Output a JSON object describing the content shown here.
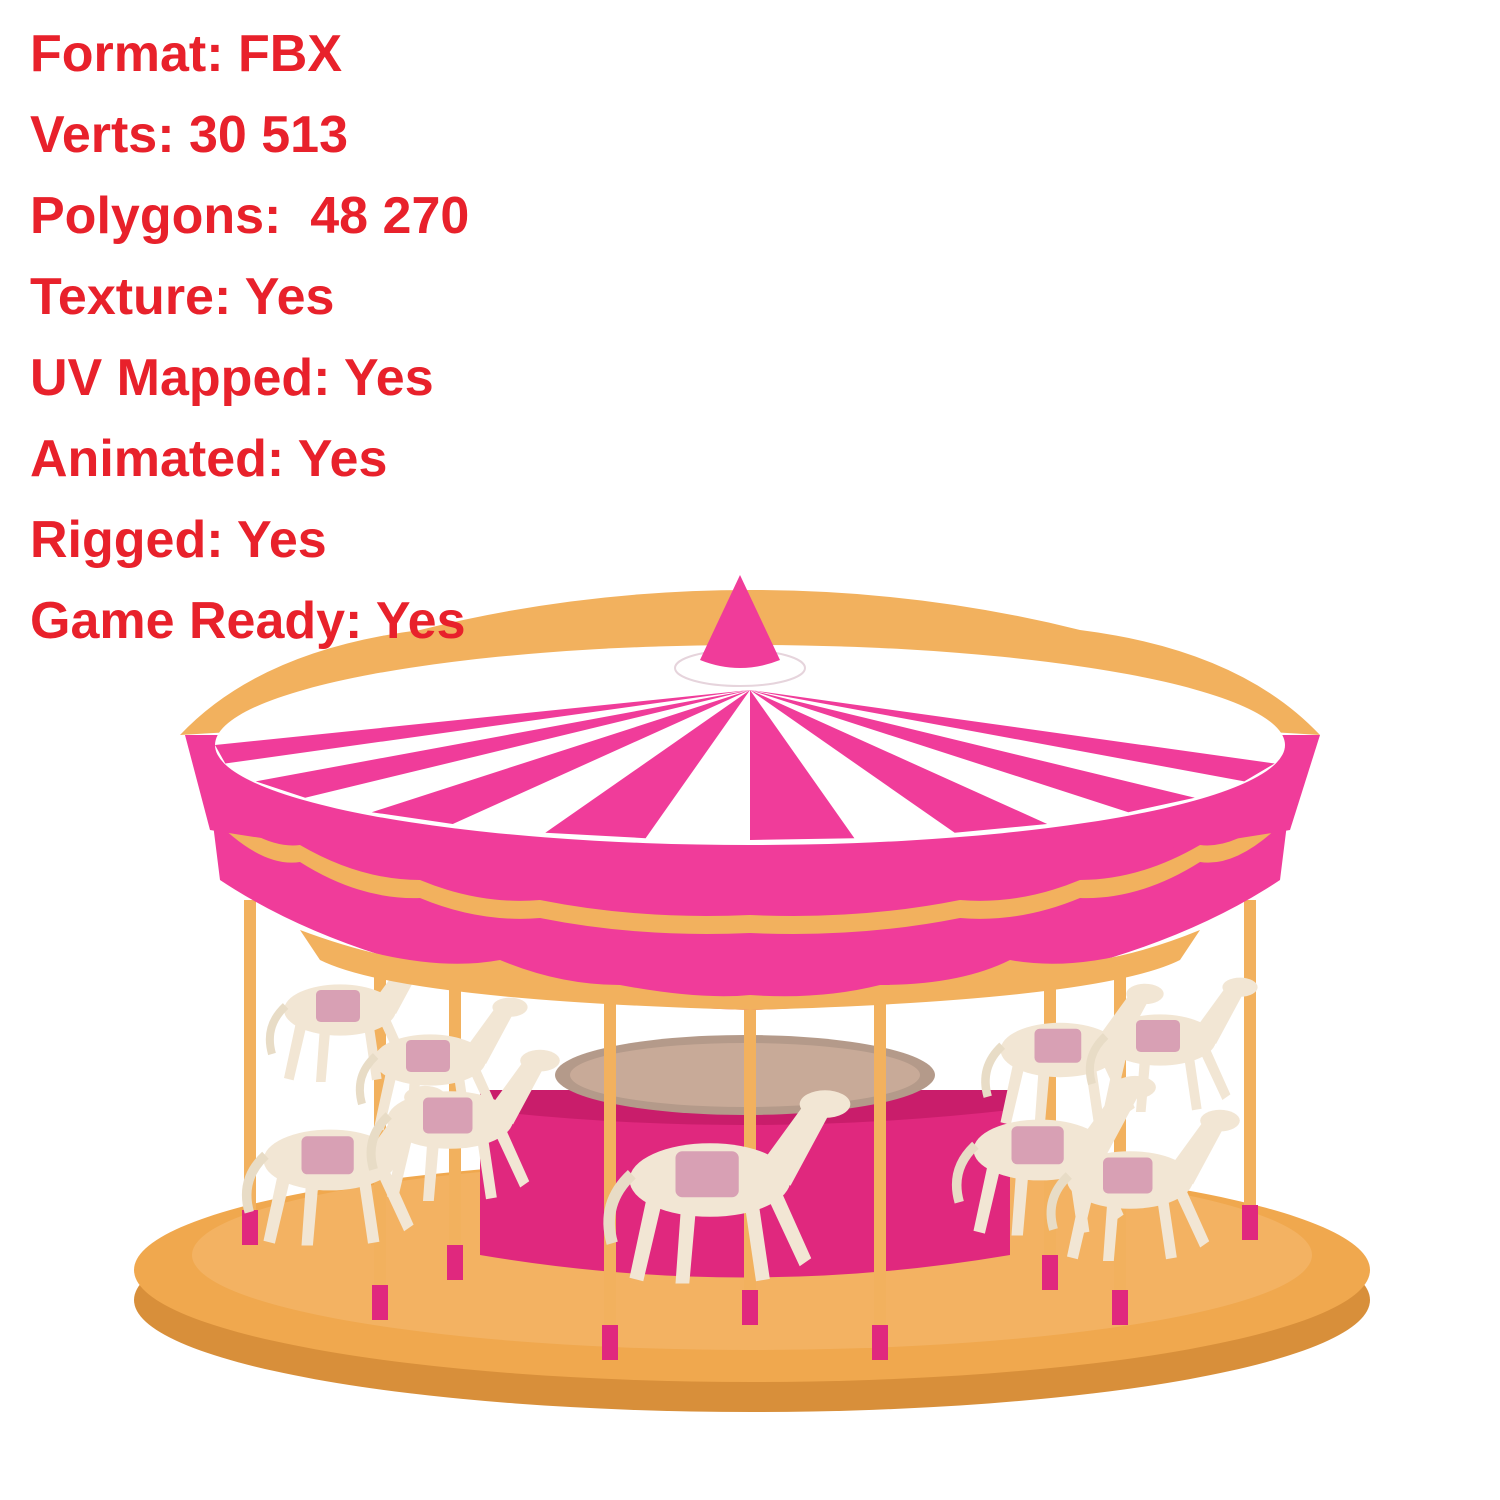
{
  "specs": {
    "format": "Format: FBX",
    "verts": "Verts: 30 513",
    "polygons": "Polygons:  48 270",
    "texture": "Texture: Yes",
    "uv_mapped": "UV Mapped: Yes",
    "animated": "Animated: Yes",
    "rigged": "Rigged: Yes",
    "game_ready": "Game Ready: Yes"
  },
  "colors": {
    "text": "#e8212b",
    "canopy_pink": "#f03c9a",
    "canopy_white": "#ffffff",
    "trim_gold": "#f2b15e",
    "base": "#f0a84e",
    "pole_pink": "#e0287e",
    "horse": "#f2e6d4"
  },
  "image": {
    "subject": "carousel-3d-model",
    "horse_count": 9
  }
}
